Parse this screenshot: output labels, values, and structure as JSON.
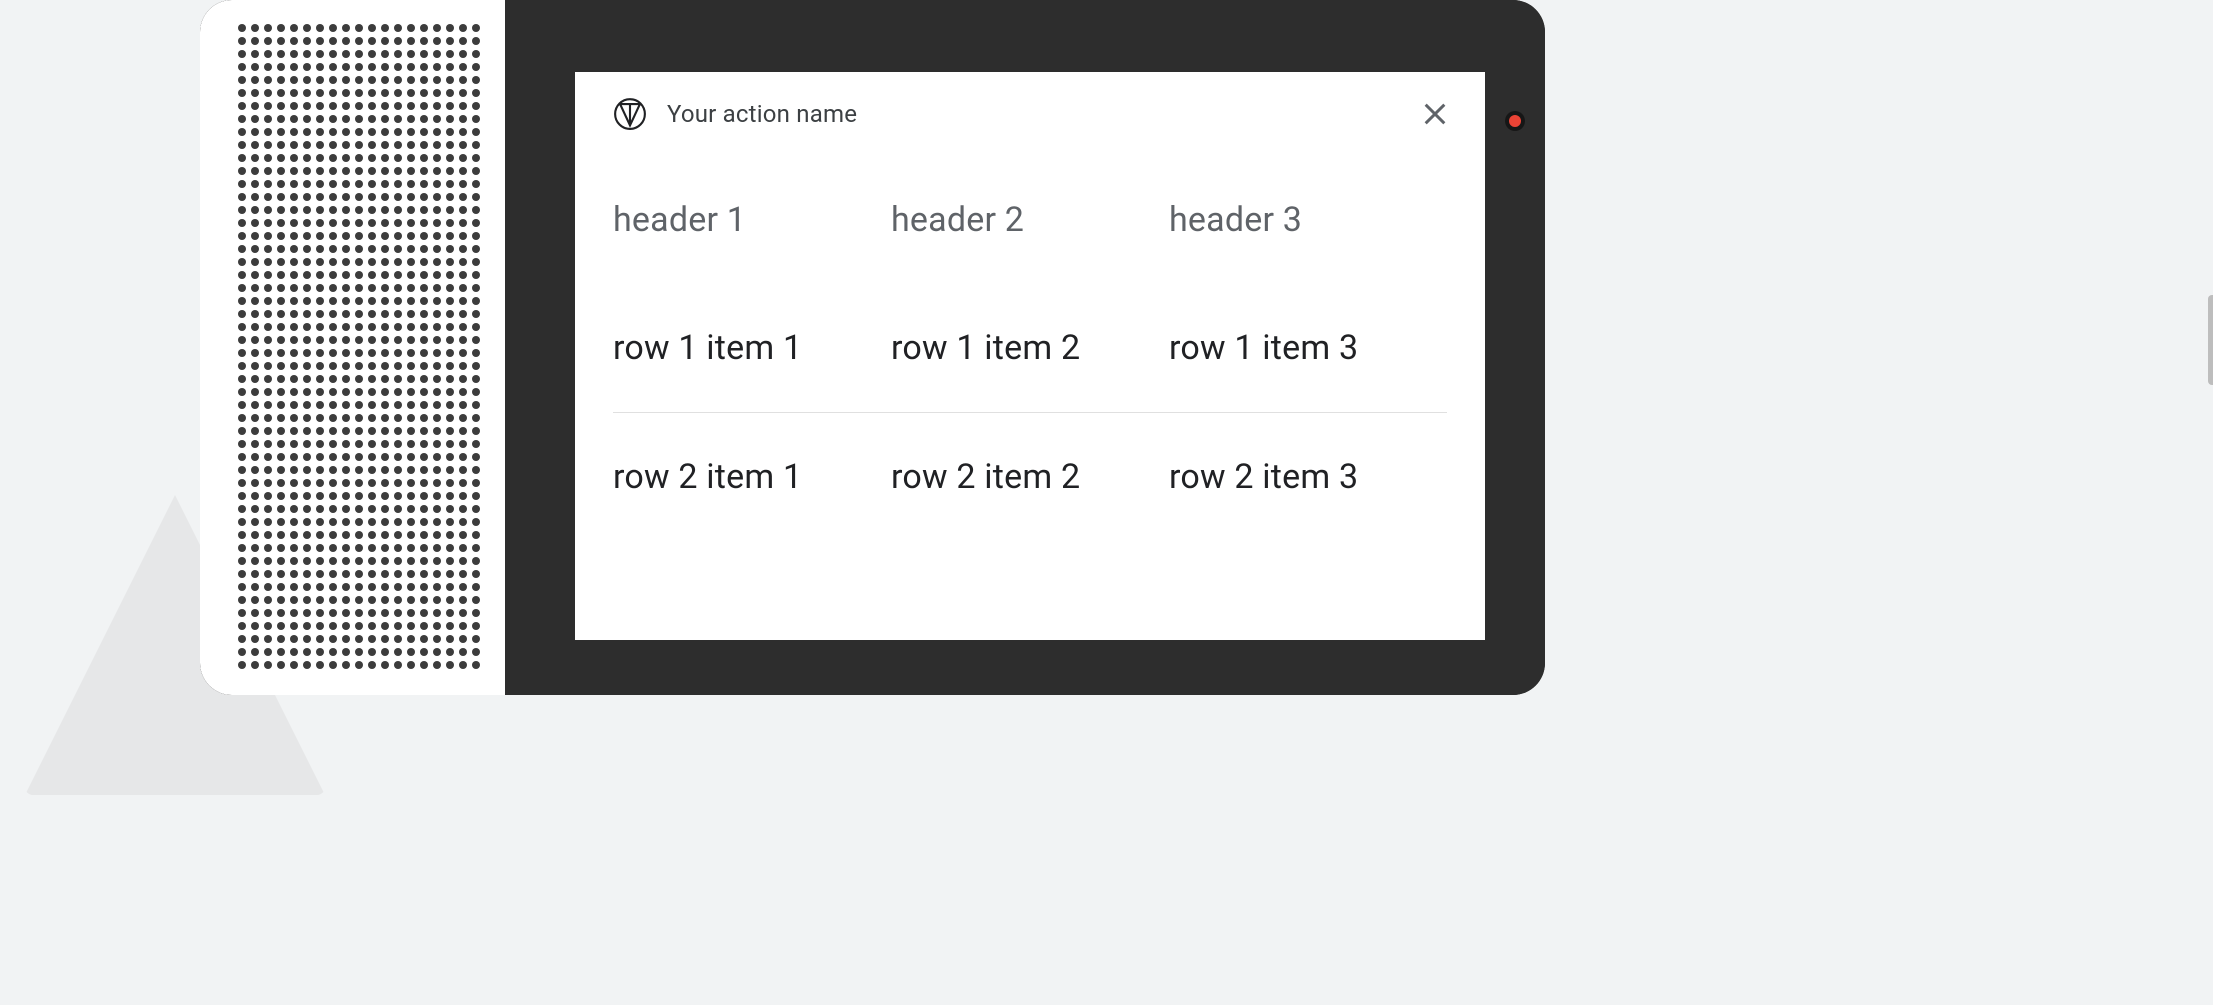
{
  "card": {
    "action_name": "Your action name",
    "close_aria": "Close"
  },
  "table": {
    "headers": [
      "header 1",
      "header 2",
      "header 3"
    ],
    "rows": [
      [
        "row 1 item 1",
        "row 1 item 2",
        "row 1 item 3"
      ],
      [
        "row 2 item 1",
        "row 2 item 2",
        "row 2 item 3"
      ]
    ]
  }
}
